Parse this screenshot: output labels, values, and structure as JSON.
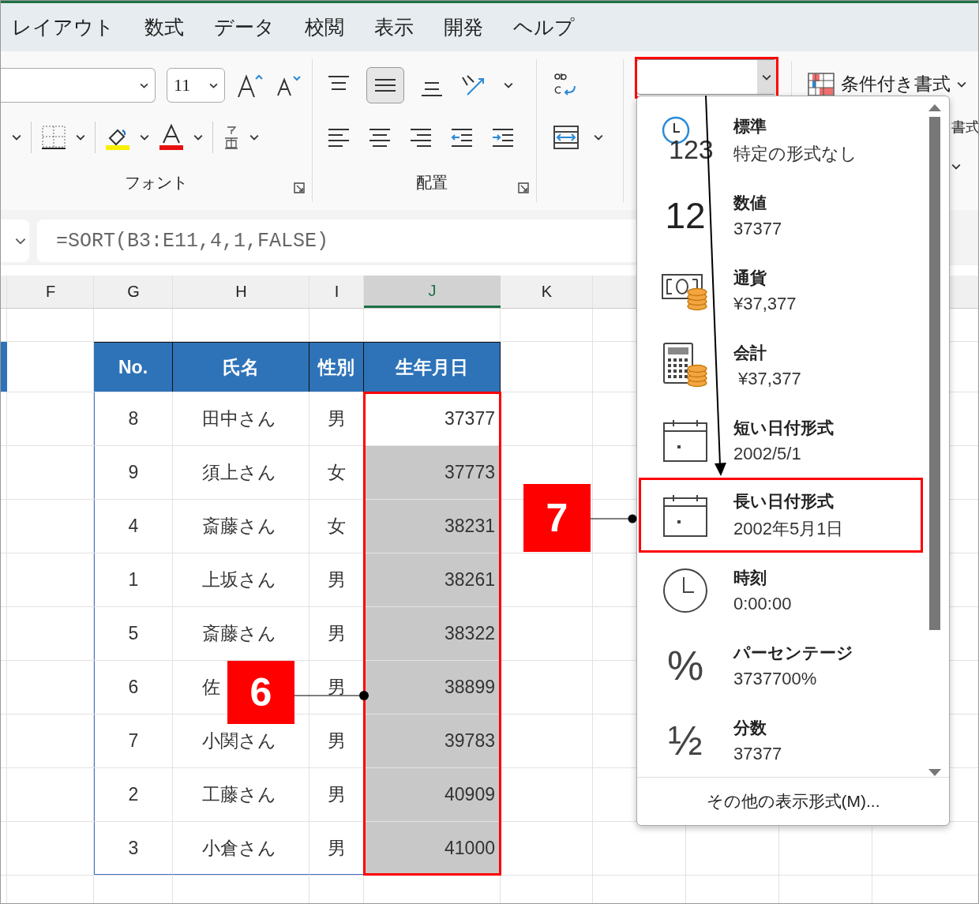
{
  "ribbon_tabs": [
    "レイアウト",
    "数式",
    "データ",
    "校閲",
    "表示",
    "開発",
    "ヘルプ"
  ],
  "ribbon": {
    "font_size": "11",
    "font_group": "フォント",
    "alignment_group": "配置",
    "conditional_format": "条件付き書式",
    "cut_label": "書式"
  },
  "formula_bar": {
    "formula": "=SORT(B3:E11,4,1,FALSE)"
  },
  "sheet": {
    "columns": [
      {
        "label": "F",
        "selected": false
      },
      {
        "label": "G",
        "selected": false
      },
      {
        "label": "H",
        "selected": false
      },
      {
        "label": "I",
        "selected": false
      },
      {
        "label": "J",
        "selected": true
      },
      {
        "label": "K",
        "selected": false
      }
    ],
    "table": {
      "columns": [
        "No.",
        "氏名",
        "性別",
        "生年月日"
      ],
      "rows": [
        {
          "no": "8",
          "name": "田中さん",
          "sex": "男",
          "birth": "37377",
          "selected": false
        },
        {
          "no": "9",
          "name": "須上さん",
          "sex": "女",
          "birth": "37773",
          "selected": true
        },
        {
          "no": "4",
          "name": "斎藤さん",
          "sex": "女",
          "birth": "38231",
          "selected": true
        },
        {
          "no": "1",
          "name": "上坂さん",
          "sex": "男",
          "birth": "38261",
          "selected": true
        },
        {
          "no": "5",
          "name": "斎藤さん",
          "sex": "男",
          "birth": "38322",
          "selected": true
        },
        {
          "no": "6",
          "name": "佐",
          "sex": "男",
          "birth": "38899",
          "selected": true
        },
        {
          "no": "7",
          "name": "小関さん",
          "sex": "男",
          "birth": "39783",
          "selected": true
        },
        {
          "no": "2",
          "name": "工藤さん",
          "sex": "男",
          "birth": "40909",
          "selected": true
        },
        {
          "no": "3",
          "name": "小倉さん",
          "sex": "男",
          "birth": "41000",
          "selected": true
        }
      ]
    }
  },
  "number_format_menu": {
    "items": [
      {
        "kind": "general",
        "glyph": "123",
        "title": "標準",
        "example": "特定の形式なし",
        "selected": false
      },
      {
        "kind": "number",
        "glyph": "12",
        "title": "数値",
        "example": "37377",
        "selected": false
      },
      {
        "kind": "currency",
        "title": "通貨",
        "example": "¥37,377",
        "selected": false
      },
      {
        "kind": "accounting",
        "title": "会計",
        "example": " ¥37,377",
        "selected": false
      },
      {
        "kind": "short_date",
        "title": "短い日付形式",
        "example": "2002/5/1",
        "selected": false
      },
      {
        "kind": "long_date",
        "title": "長い日付形式",
        "example": "2002年5月1日",
        "selected": true
      },
      {
        "kind": "time",
        "title": "時刻",
        "example": "0:00:00",
        "selected": false
      },
      {
        "kind": "percent",
        "glyph": "%",
        "title": "パーセンテージ",
        "example": "3737700%",
        "selected": false
      },
      {
        "kind": "fraction",
        "glyph": "½",
        "title": "分数",
        "example": "37377",
        "selected": false
      }
    ],
    "more": "その他の表示形式(M)..."
  },
  "callouts": [
    "6",
    "7"
  ]
}
